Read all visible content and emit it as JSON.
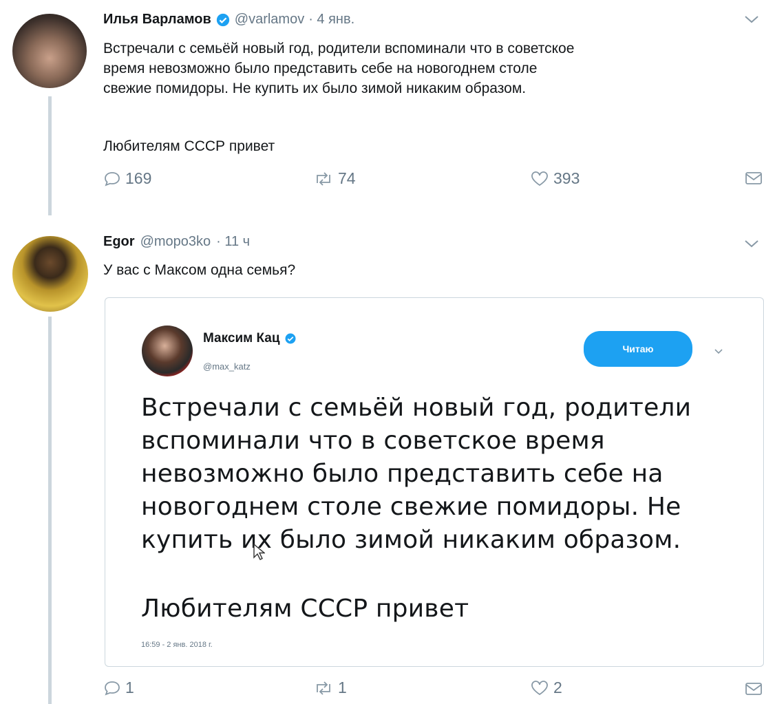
{
  "tweet1": {
    "name": "Илья Варламов",
    "handle": "@varlamov",
    "time": "· 4 янв.",
    "text": "Встречали с семьёй новый год, родители вспоминали что в советское\nвремя невозможно было представить себе на новогоднем столе\nсвежие помидоры. Не купить их было зимой никаким образом.",
    "text2": "Любителям СССР привет",
    "replies": "169",
    "retweets": "74",
    "likes": "393"
  },
  "tweet2": {
    "name": "Egor",
    "handle": "@moро3ko",
    "time": "· 11 ч",
    "text": "У вас с Максом одна семья?",
    "replies": "1",
    "retweets": "1",
    "likes": "2"
  },
  "quoted": {
    "name": "Максим Кац",
    "handle": "@max_katz",
    "follow_label": "Читаю",
    "text": "Встречали с семьёй новый год, родители\nвспоминали что в советское время\nневозможно было представить себе на\nновогоднем столе свежие помидоры. Не\nкупить их было зимой никаким образом.",
    "text2": "Любителям СССР привет",
    "timestamp": "16:59 - 2 янв. 2018 г."
  },
  "colors": {
    "verified": "#1da1f2",
    "muted": "#657786",
    "accent": "#1da1f2"
  }
}
